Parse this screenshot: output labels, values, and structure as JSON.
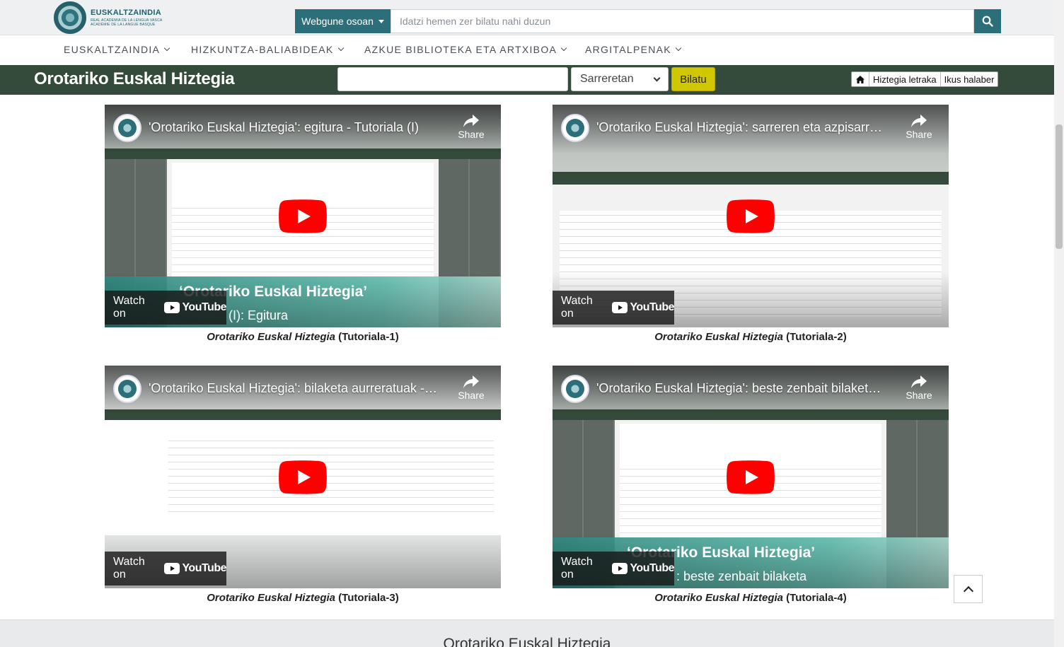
{
  "header": {
    "logo": {
      "name": "EUSKALTZAINDIA",
      "sub1": "REAL ACADEMIA DE LA LENGUA VASCA",
      "sub2": "ACADÉMIE DE LA LANGUE BASQUE"
    },
    "scope_label": "Webgune osoan",
    "search_placeholder": "Idatzi hemen zer bilatu nahi duzun"
  },
  "nav": {
    "items": [
      {
        "label": "EUSKALTZAINDIA"
      },
      {
        "label": "HIZKUNTZA-BALIABIDEAK"
      },
      {
        "label": "AZKUE BIBLIOTEKA ETA ARTXIBOA"
      },
      {
        "label": "ARGITALPENAK"
      }
    ]
  },
  "dictionary": {
    "title": "Orotariko Euskal Hiztegia",
    "search_value": "",
    "select_value": "Sarreretan",
    "search_button": "Bilatu",
    "links": [
      "Hiztegia letraka",
      "Ikus halaber"
    ]
  },
  "videos": [
    {
      "title": "'Orotariko Euskal Hiztegia': egitura - Tutoriala (I)",
      "overlay_title": "‘Orotariko Euskal Hiztegia’",
      "overlay_sub": "(I): Egitura",
      "caption_italic": "Orotariko Euskal Hiztegia",
      "caption_rest": " (Tutoriala-1)"
    },
    {
      "title": "'Orotariko Euskal Hiztegia': sarreren eta azpisarreren bilaketa",
      "overlay_title": "",
      "overlay_sub": "",
      "caption_italic": "Orotariko Euskal Hiztegia",
      "caption_rest": " (Tutoriala-2)"
    },
    {
      "title": "'Orotariko Euskal Hiztegia': bilaketa aurreratuak - Tutoriala (III)",
      "overlay_title": "",
      "overlay_sub": "",
      "caption_italic": "Orotariko Euskal Hiztegia",
      "caption_rest": " (Tutoriala-3)"
    },
    {
      "title": "'Orotariko Euskal Hiztegia': beste zenbait bilaketa - Tutoriala (IV)",
      "overlay_title": "‘Orotariko Euskal Hiztegia’",
      "overlay_sub": ": beste zenbait bilaketa",
      "caption_italic": "Orotariko Euskal Hiztegia",
      "caption_rest": " (Tutoriala-4)"
    }
  ],
  "player": {
    "share_label": "Share",
    "watch_on_label": "Watch on",
    "youtube_word": "YouTube"
  },
  "footer": {
    "title": "Orotariko Euskal Hiztegia"
  },
  "colors": {
    "teal": "#2c6e79",
    "dark_green": "#344a3a",
    "yellow": "#d1c700",
    "yt_red": "#ff0000"
  }
}
